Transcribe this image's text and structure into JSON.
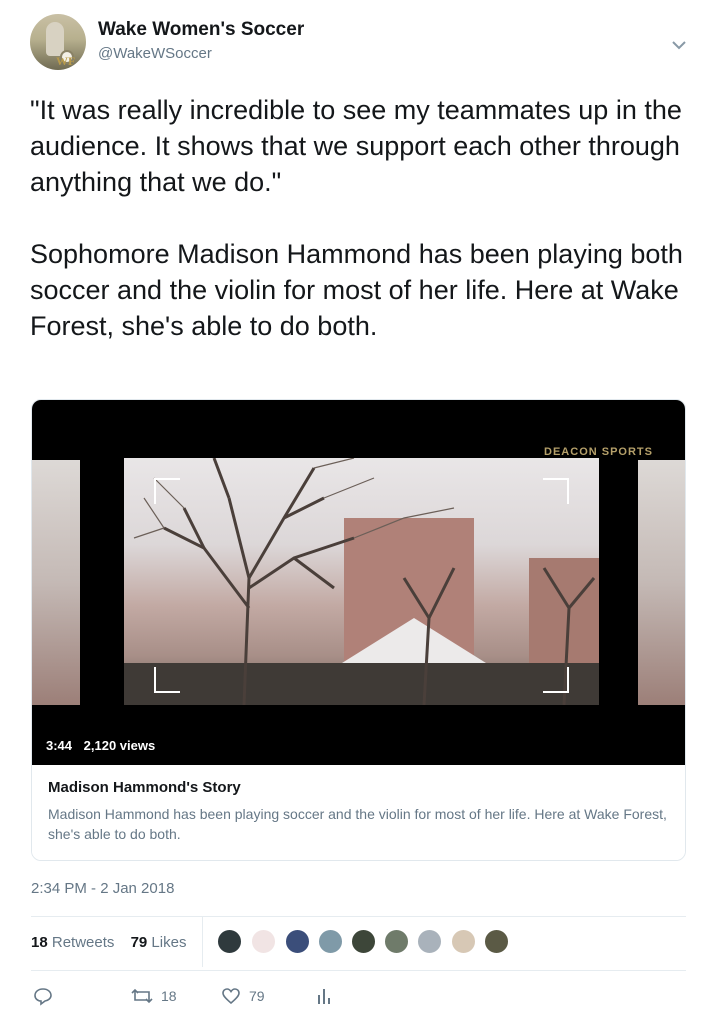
{
  "tweet": {
    "author_name": "Wake Women's Soccer",
    "author_handle": "@WakeWSoccer",
    "avatar_badge": "WF",
    "text": "\"It was really incredible to see my teammates up in the audience. It shows that we support each other through anything that we do.\"\n\nSophomore Madison Hammond has been playing both soccer and the violin for most of her life. Here at Wake Forest, she's able to do both.",
    "timestamp": "2:34 PM - 2 Jan 2018"
  },
  "card": {
    "duration": "3:44",
    "views": "2,120 views",
    "title": "Madison Hammond's Story",
    "description": "Madison Hammond has been playing soccer and the violin for most of her life. Here at Wake Forest, she's able to do both.",
    "watermark": "DEACON SPORTS"
  },
  "stats": {
    "retweets_count": "18",
    "retweets_label": "Retweets",
    "likes_count": "79",
    "likes_label": "Likes",
    "liker_avatars": 9
  },
  "actions": {
    "reply_icon": "reply-icon",
    "retweet_icon": "retweet-icon",
    "retweet_count": "18",
    "like_icon": "heart-icon",
    "like_count": "79",
    "analytics_icon": "analytics-icon"
  },
  "colors": {
    "text": "#14171a",
    "secondary": "#657786",
    "border": "#e1e8ed"
  }
}
